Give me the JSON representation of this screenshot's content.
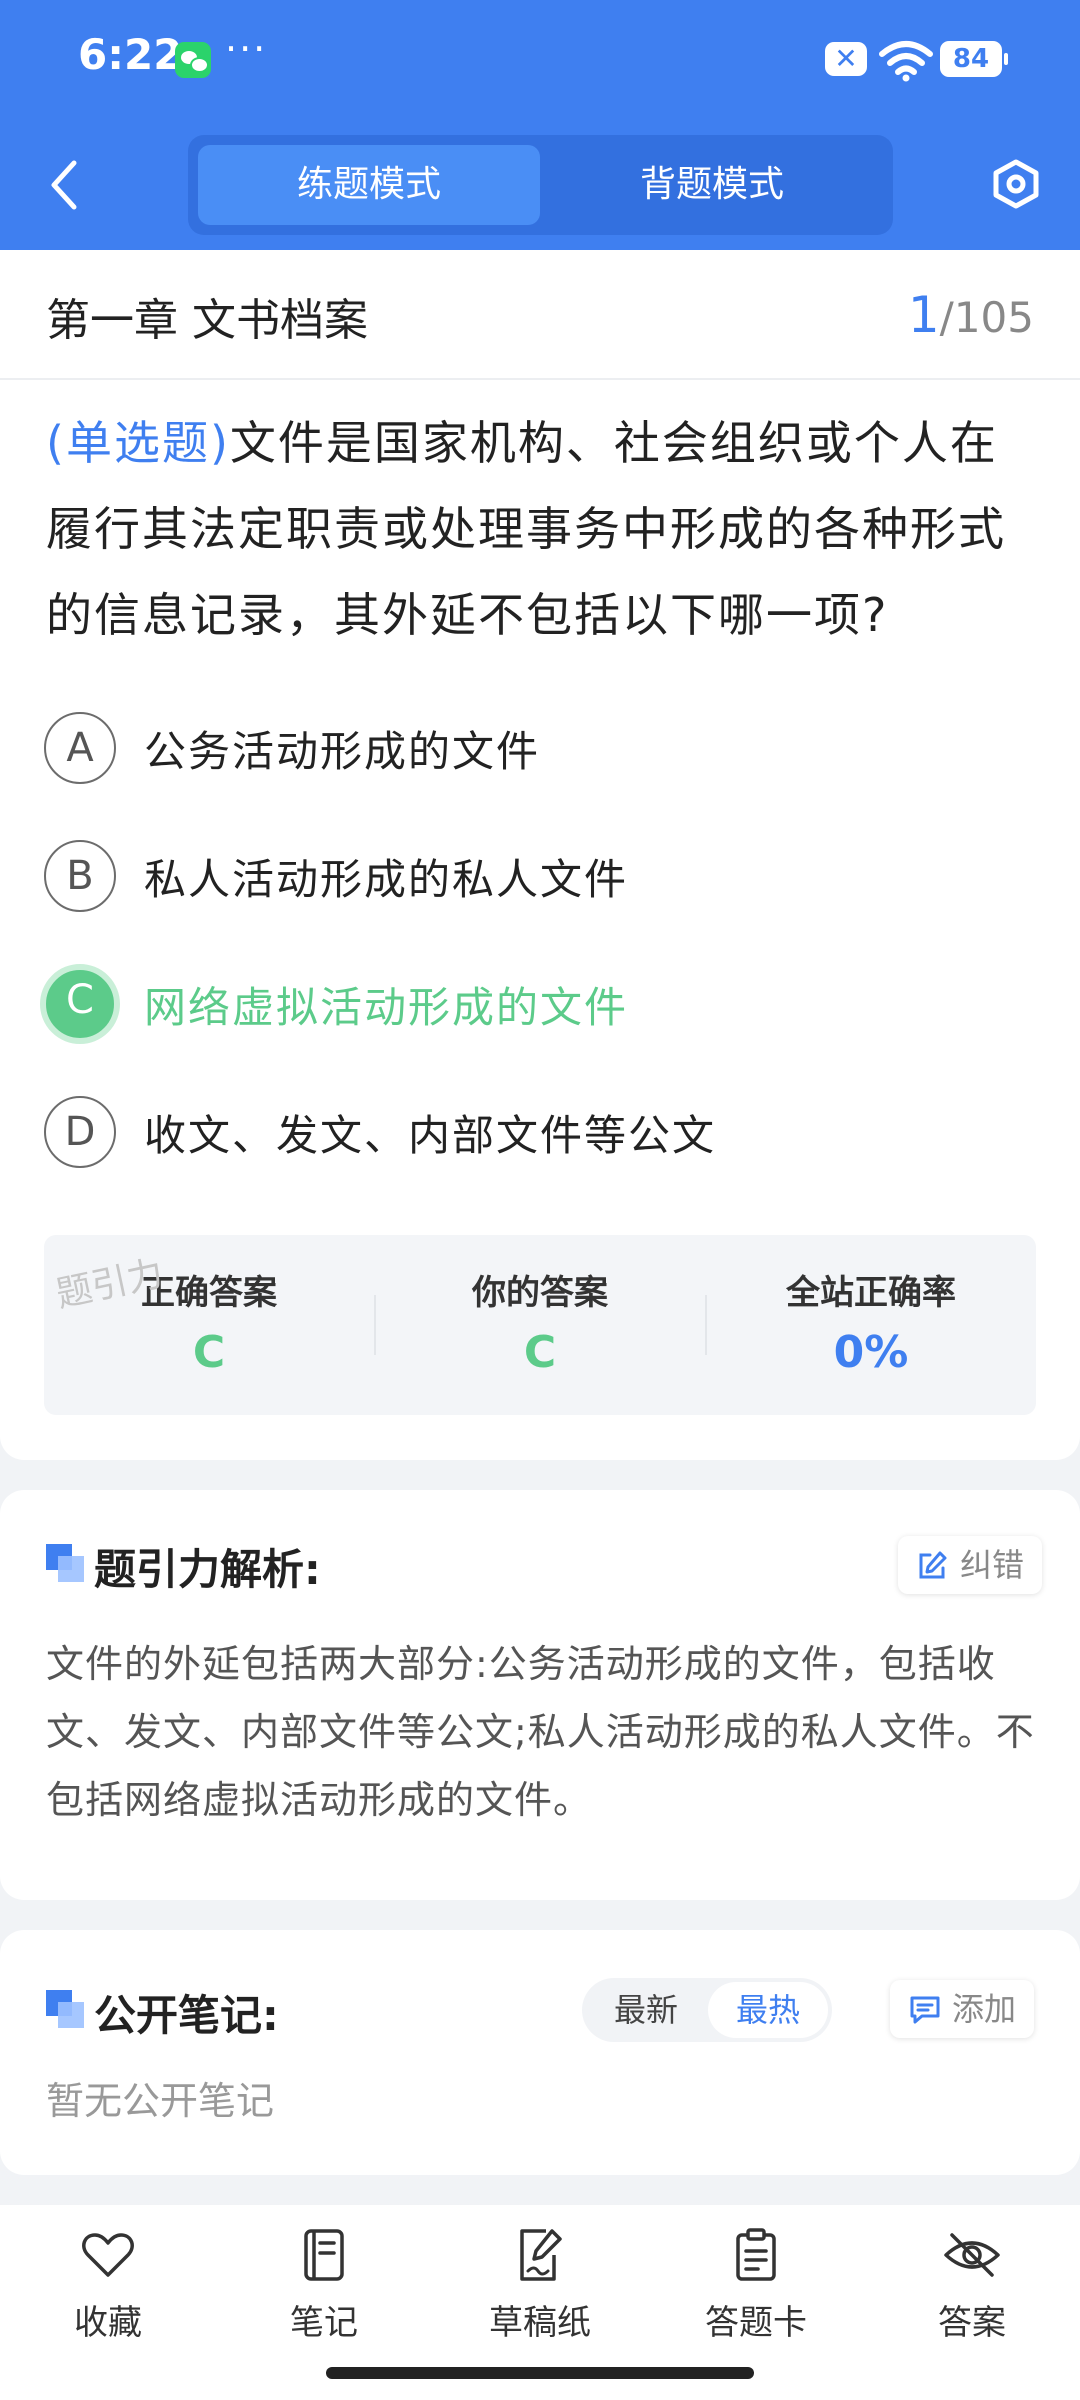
{
  "status_bar": {
    "time": "6:22",
    "battery": "84"
  },
  "header": {
    "mode_tabs": [
      {
        "label": "练题模式",
        "active": true
      },
      {
        "label": "背题模式",
        "active": false
      }
    ]
  },
  "question": {
    "chapter": "第一章 文书档案",
    "current": "1",
    "total": "/105",
    "type_label": "(单选题)",
    "text": "文件是国家机构、社会组织或个人在履行其法定职责或处理事务中形成的各种形式的信息记录，其外延不包括以下哪一项?",
    "options": [
      {
        "letter": "A",
        "text": "公务活动形成的文件"
      },
      {
        "letter": "B",
        "text": "私人活动形成的私人文件"
      },
      {
        "letter": "C",
        "text": "网络虚拟活动形成的文件",
        "correct": true
      },
      {
        "letter": "D",
        "text": "收文、发文、内部文件等公文"
      }
    ]
  },
  "stats": {
    "correct_label": "正确答案",
    "correct_value": "C",
    "yours_label": "你的答案",
    "yours_value": "C",
    "rate_label": "全站正确率",
    "rate_value": "0%",
    "watermark": "题引力"
  },
  "analysis": {
    "title": "题引力解析:",
    "report_label": "纠错",
    "text": "文件的外延包括两大部分:公务活动形成的文件，包括收文、发文、内部文件等公文;私人活动形成的私人文件。不包括网络虚拟活动形成的文件。"
  },
  "notes": {
    "title": "公开笔记:",
    "sort_latest": "最新",
    "sort_hot": "最热",
    "add_label": "添加",
    "empty_text": "暂无公开笔记"
  },
  "bottom_tabs": [
    {
      "label": "收藏",
      "icon": "heart-icon"
    },
    {
      "label": "笔记",
      "icon": "notebook-icon"
    },
    {
      "label": "草稿纸",
      "icon": "draft-icon"
    },
    {
      "label": "答题卡",
      "icon": "clipboard-icon"
    },
    {
      "label": "答案",
      "icon": "eye-off-icon"
    }
  ],
  "colors": {
    "primary": "#3f7ff0",
    "correct": "#5ccb8a"
  }
}
